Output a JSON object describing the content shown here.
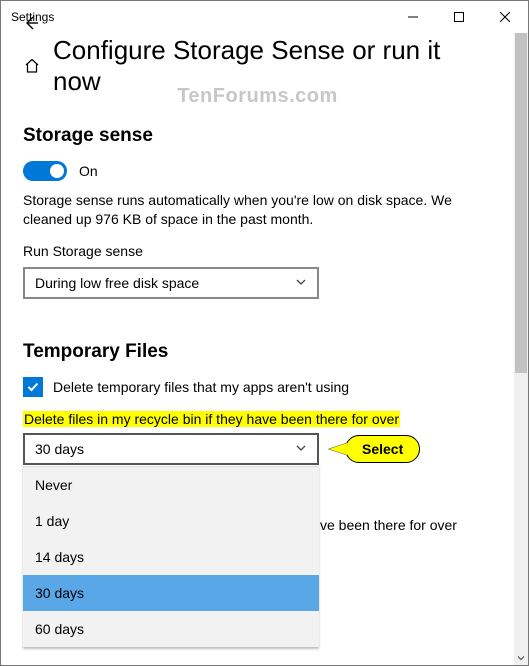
{
  "window": {
    "app_title": "Settings"
  },
  "watermark": "TenForums.com",
  "header": {
    "page_title": "Configure Storage Sense or run it now"
  },
  "storage_sense": {
    "section_title": "Storage sense",
    "toggle_state": "On",
    "description": "Storage sense runs automatically when you're low on disk space. We cleaned up 976 KB of space in the past month.",
    "schedule_label": "Run Storage sense",
    "schedule_value": "During low free disk space"
  },
  "temporary_files": {
    "section_title": "Temporary Files",
    "checkbox_label": "Delete temporary files that my apps aren't using",
    "recycle_label": "Delete files in my recycle bin if they have been there for over",
    "recycle_value": "30 days",
    "recycle_options": [
      "Never",
      "1 day",
      "14 days",
      "30 days",
      "60 days"
    ],
    "downloads_label_fragment": "ve been there for over"
  },
  "callout": {
    "text": "Select"
  }
}
